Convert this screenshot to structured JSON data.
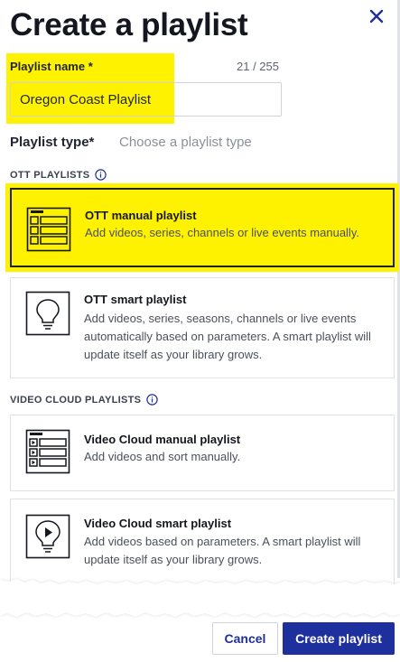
{
  "dialog": {
    "title": "Create a playlist",
    "close_icon": "close-icon"
  },
  "name_field": {
    "label": "Playlist name *",
    "counter": "21 / 255",
    "value": "Oregon Coast Playlist",
    "placeholder": ""
  },
  "type_field": {
    "label": "Playlist type*",
    "value": "Choose a playlist type"
  },
  "sections": {
    "ott": {
      "heading": "OTT PLAYLISTS",
      "icon": "info-icon",
      "cards": [
        {
          "title": "OTT manual playlist",
          "description": "Add videos, series, channels or live events manually.",
          "icon": "manual-playlist-grid-icon",
          "highlighted": true
        },
        {
          "title": "OTT smart playlist",
          "description": "Add videos, series, seasons, channels or live events automatically based on parameters. A smart playlist will update itself as your library grows.",
          "icon": "lightbulb-icon",
          "highlighted": false
        }
      ]
    },
    "video_cloud": {
      "heading": "VIDEO CLOUD PLAYLISTS",
      "icon": "info-icon",
      "cards": [
        {
          "title": "Video Cloud manual playlist",
          "description": "Add videos and sort manually.",
          "icon": "video-list-icon",
          "highlighted": false
        },
        {
          "title": "Video Cloud smart playlist",
          "description": "Add videos based on parameters. A smart playlist will update itself as your library grows.",
          "icon": "play-lightbulb-icon",
          "highlighted": false
        }
      ]
    }
  },
  "footer": {
    "cancel_label": "Cancel",
    "create_label": "Create playlist"
  },
  "colors": {
    "highlight": "#fff200",
    "primary": "#1e2f9e",
    "text": "#1f2430",
    "muted": "#8a909a",
    "border": "#dfe2e7"
  }
}
